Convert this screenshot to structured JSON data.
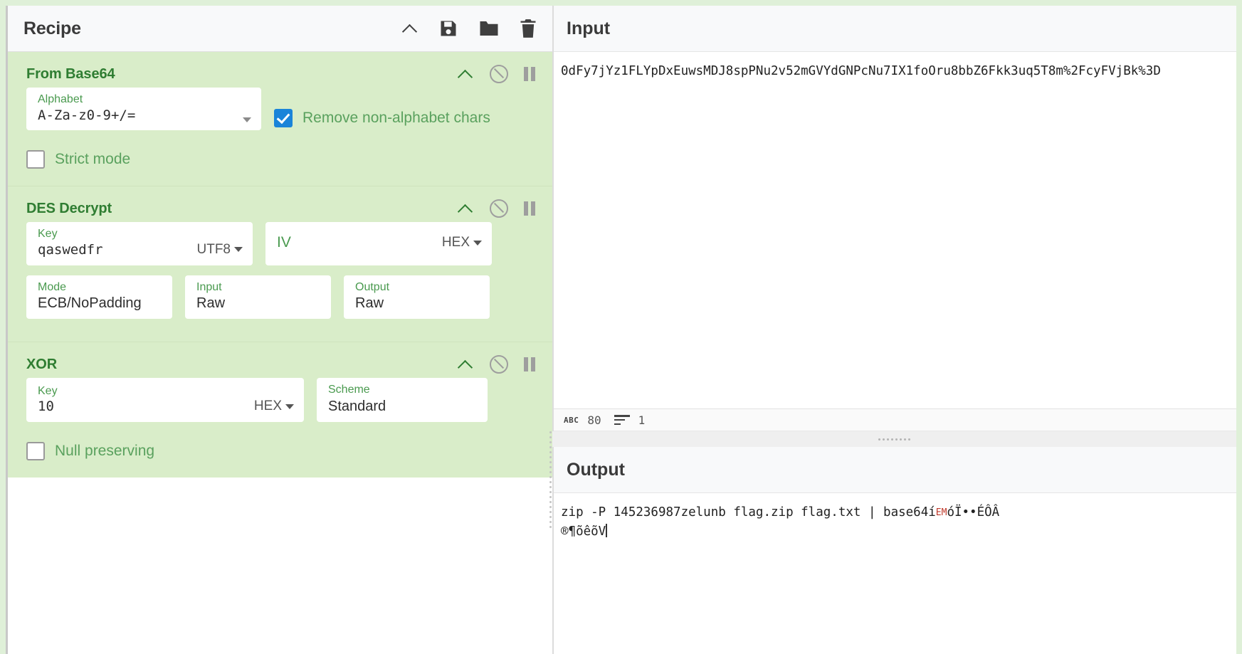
{
  "recipe": {
    "title": "Recipe",
    "controls": [
      {
        "name": "collapse-icon",
        "label": "collapse"
      },
      {
        "name": "save-icon",
        "label": "save"
      },
      {
        "name": "load-icon",
        "label": "folder"
      },
      {
        "name": "clear-icon",
        "label": "trash"
      }
    ],
    "operations": [
      {
        "title": "From Base64",
        "args": [
          {
            "label": "Alphabet",
            "value": "A-Za-z0-9+/=",
            "suffix": "",
            "dropdown": true
          },
          {
            "label": "",
            "value": "",
            "checkbox": {
              "label": "Remove non-alphabet chars",
              "checked": true
            }
          }
        ]
      },
      {
        "title": "DES Decrypt",
        "args": [
          {
            "label": "Key",
            "value": "qaswedfr",
            "suffix": "UTF8"
          },
          {
            "label": "IV",
            "value": "",
            "suffix": "HEX"
          },
          {
            "label": "Mode",
            "value": "ECB/NoPadding"
          },
          {
            "label": "Input",
            "value": "Raw"
          },
          {
            "label": "Output",
            "value": "Raw"
          }
        ]
      },
      {
        "title": "XOR",
        "args": [
          {
            "label": "Key",
            "value": "10",
            "suffix": "HEX"
          },
          {
            "label": "Scheme",
            "value": "Standard"
          },
          {
            "label": "",
            "value": "",
            "checkbox": {
              "label": "Null preserving",
              "checked": false
            }
          }
        ]
      }
    ],
    "op_icons": {
      "collapse": "chevron-up-icon",
      "disable": "ban-icon",
      "breakpoint": "pause-icon"
    }
  },
  "base64_op": {
    "title": "From Base64",
    "alphabet_label": "Alphabet",
    "alphabet_value": "A-Za-z0-9+/=",
    "remove_non_alphabet_label": "Remove non-alphabet chars",
    "strict_mode_label": "Strict mode"
  },
  "des_op": {
    "title": "DES Decrypt",
    "key_label": "Key",
    "key_value": "qaswedfr",
    "key_format": "UTF8",
    "iv_label": "IV",
    "iv_value": "",
    "iv_format": "HEX",
    "mode_label": "Mode",
    "mode_value": "ECB/NoPadding",
    "input_label": "Input",
    "input_value": "Raw",
    "output_label": "Output",
    "output_value": "Raw"
  },
  "xor_op": {
    "title": "XOR",
    "key_label": "Key",
    "key_value": "10",
    "key_format": "HEX",
    "scheme_label": "Scheme",
    "scheme_value": "Standard",
    "null_preserving_label": "Null preserving"
  },
  "input": {
    "title": "Input",
    "text": "0dFy7jYz1FLYpDxEuwsMDJ8spPNu2v52mGVYdGNPcNu7IX1foOru8bbZ6Fkk3uq5T8m%2FcyFVjBk%3D",
    "status": {
      "length_icon": "ABC",
      "length": "80",
      "lines_icon": "lines-icon",
      "lines": "1"
    }
  },
  "output": {
    "title": "Output",
    "text_line1": "zip -P 145236987zelunb flag.zip flag.txt | base64í",
    "text_em": "EM",
    "text_line1b": "óÏ••ÉÔÂ",
    "text_line2": "®¶õêõV"
  },
  "colors": {
    "op_green_bg": "#d9edc9",
    "op_title": "#2f7d32",
    "label_green": "#4a9a4f",
    "checkbox_blue": "#1a84d9",
    "app_bg": "#dff0d8"
  }
}
